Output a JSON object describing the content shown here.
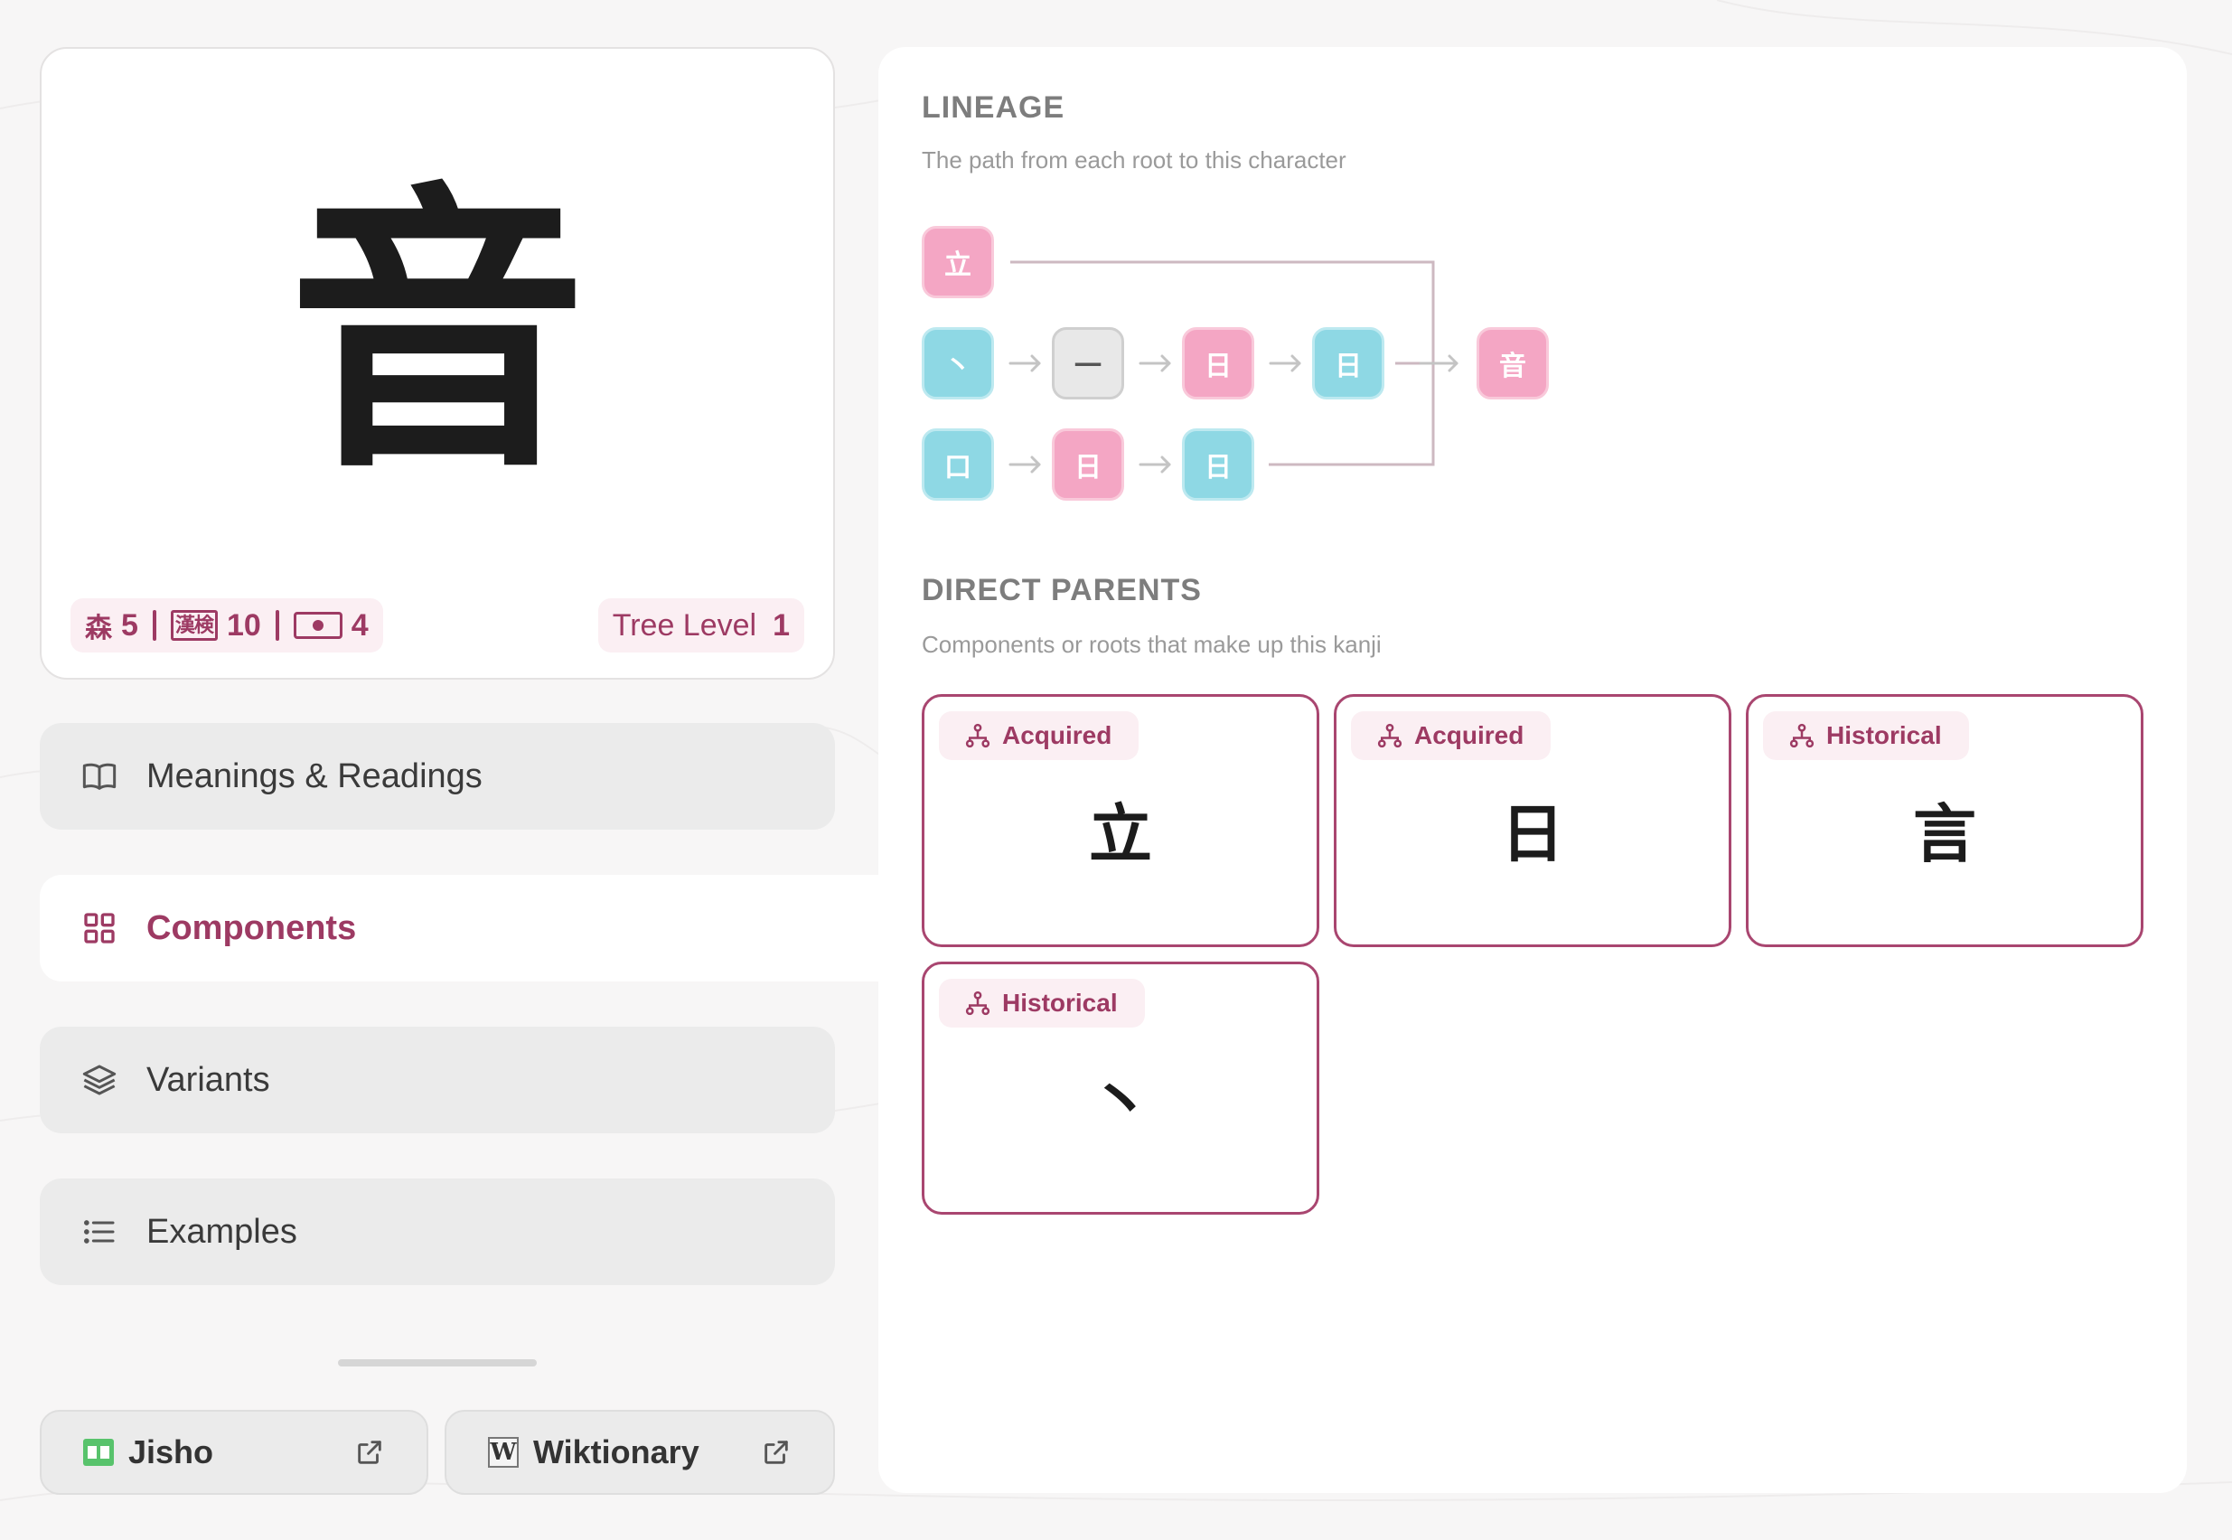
{
  "kanji": {
    "character": "音",
    "stats": {
      "stroke_glyph": "森",
      "stroke_count": "5",
      "kanken_label": "漢検",
      "kanken_level": "10",
      "jlpt_level": "4"
    },
    "tree_level_label": "Tree Level",
    "tree_level_value": "1"
  },
  "nav": {
    "meanings": "Meanings & Readings",
    "components": "Components",
    "variants": "Variants",
    "examples": "Examples"
  },
  "external": {
    "jisho": "Jisho",
    "wiktionary": "Wiktionary",
    "wiktionary_logo": "W"
  },
  "lineage": {
    "title": "LINEAGE",
    "subtitle": "The path from each root to this character",
    "rows": [
      [
        {
          "char": "立",
          "color": "pink"
        }
      ],
      [
        {
          "char": "丶",
          "color": "blue"
        },
        {
          "char": "一",
          "color": "gray"
        },
        {
          "char": "日",
          "color": "pink"
        },
        {
          "char": "日",
          "color": "blue"
        }
      ],
      [
        {
          "char": "口",
          "color": "blue"
        },
        {
          "char": "日",
          "color": "pink"
        },
        {
          "char": "日",
          "color": "blue"
        }
      ]
    ],
    "result": {
      "char": "音",
      "color": "pink"
    }
  },
  "parents": {
    "title": "DIRECT PARENTS",
    "subtitle": "Components or roots that make up this kanji",
    "items": [
      {
        "type": "Acquired",
        "char": "立"
      },
      {
        "type": "Acquired",
        "char": "日"
      },
      {
        "type": "Historical",
        "char": "言"
      },
      {
        "type": "Historical",
        "char": "丶"
      }
    ]
  },
  "colors": {
    "accent": "#9d3a63",
    "tile_pink": "#f4a6c4",
    "tile_blue": "#8ed8e4",
    "tile_gray": "#e8e8e8"
  }
}
